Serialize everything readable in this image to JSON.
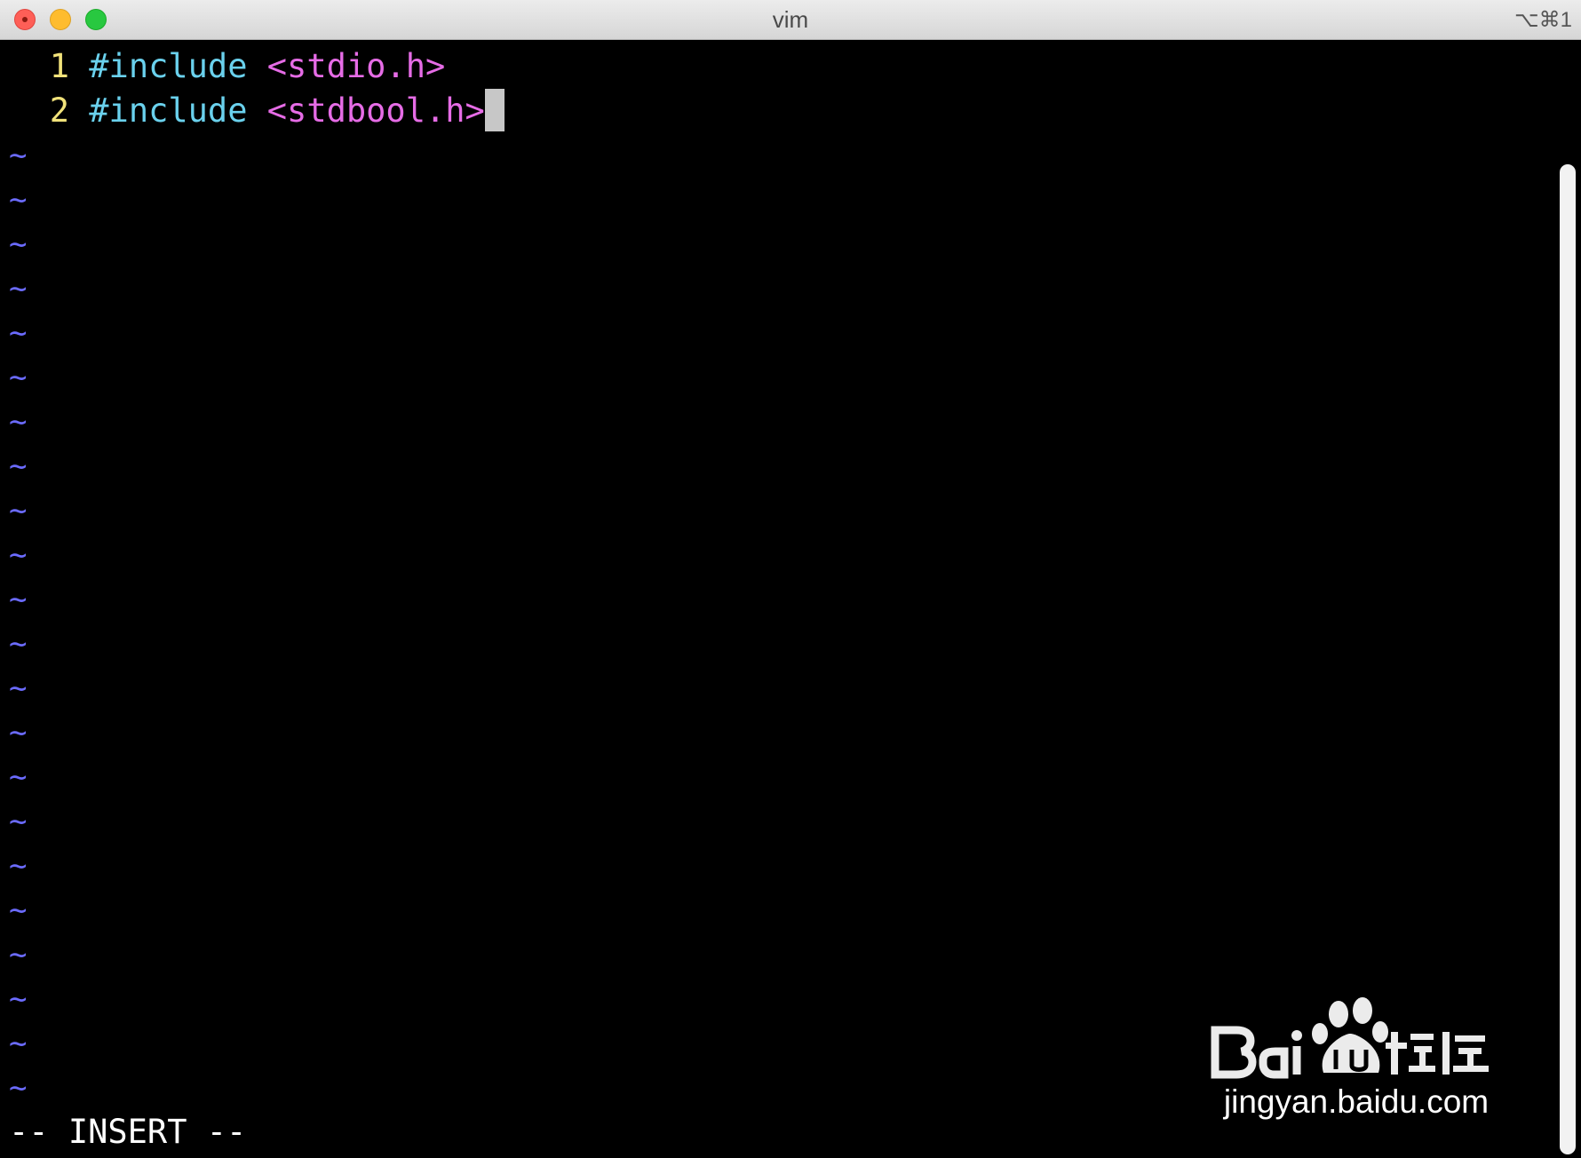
{
  "window": {
    "title": "vim",
    "tab_shortcut": "⌥⌘1"
  },
  "editor": {
    "lines": [
      {
        "number": "1",
        "keyword": "#include",
        "header": "<stdio.h>"
      },
      {
        "number": "2",
        "keyword": "#include",
        "header": "<stdbool.h>"
      }
    ],
    "tilde": "~",
    "mode": "-- INSERT --"
  },
  "watermark": {
    "brand": "Bai du 经验",
    "url": "jingyan.baidu.com"
  },
  "colors": {
    "line_number": "#f1e27a",
    "keyword": "#6ad1ed",
    "string": "#e66ce6",
    "tilde": "#6b6bff",
    "background": "#000000"
  }
}
